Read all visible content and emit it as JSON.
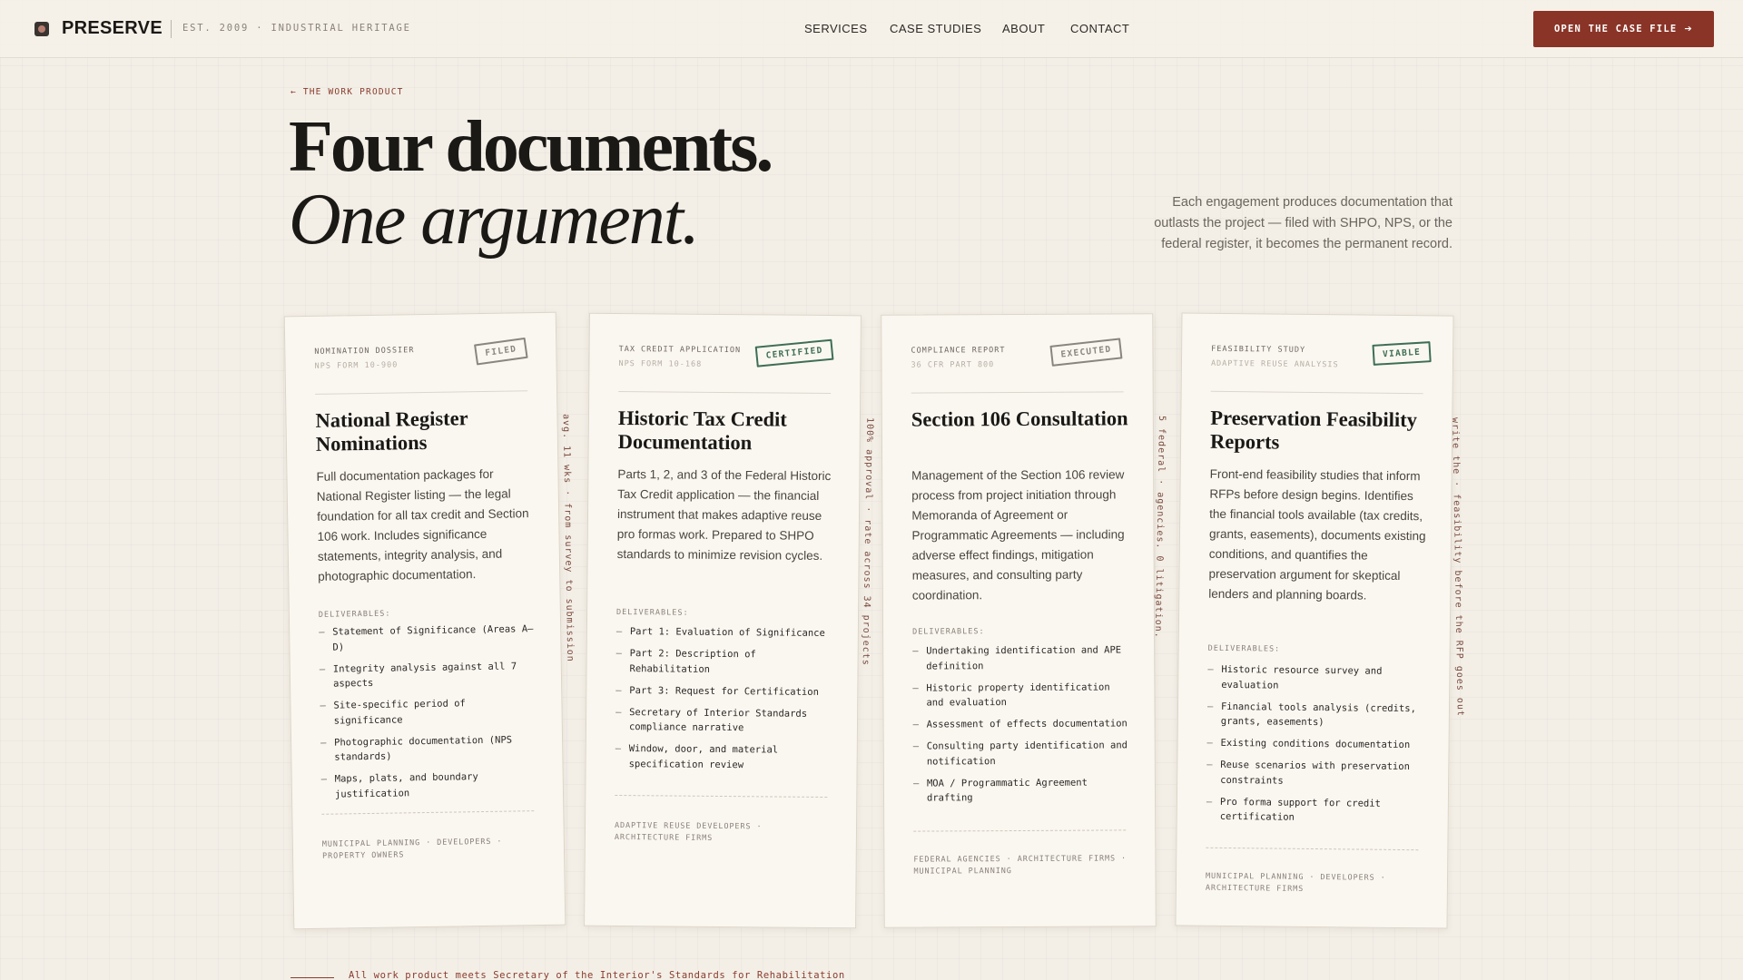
{
  "header": {
    "brand": "PRESERVE",
    "tagline": "EST. 2009 · INDUSTRIAL HERITAGE",
    "nav": [
      "SERVICES",
      "CASE STUDIES",
      "ABOUT",
      "CONTACT"
    ],
    "cta": "OPEN THE CASE FILE",
    "cta_icon": "arrow-right-icon"
  },
  "hero": {
    "back_link": "← THE WORK PRODUCT",
    "title_line1": "Four documents.",
    "title_line2": "One argument.",
    "intro": "Each engagement produces documentation that outlasts the project — filed with SHPO, NPS, or the federal register, it becomes the permanent record."
  },
  "cards": [
    {
      "kicker": "NOMINATION DOSSIER",
      "form": "NPS FORM 10-900",
      "stamp": "FILED",
      "stamp_color": "#8a857f",
      "title": "National Register Nominations",
      "description": "Full documentation packages for National Register listing — the legal foundation for all tax credit and Section 106 work. Includes significance statements, integrity analysis, and photographic documentation.",
      "deliverables_label": "DELIVERABLES:",
      "deliverables": [
        "Statement of Significance (Areas A–D)",
        "Integrity analysis against all 7 aspects",
        "Site-specific period of significance",
        "Photographic documentation (NPS standards)",
        "Maps, plats, and boundary justification"
      ],
      "audience": "MUNICIPAL PLANNING · DEVELOPERS · PROPERTY OWNERS",
      "side_note": "avg. 11 wks · from survey to submission"
    },
    {
      "kicker": "TAX CREDIT APPLICATION",
      "form": "NPS FORM 10-168",
      "stamp": "CERTIFIED",
      "stamp_color": "#3e6e54",
      "title": "Historic Tax Credit Documentation",
      "description": "Parts 1, 2, and 3 of the Federal Historic Tax Credit application — the financial instrument that makes adaptive reuse pro formas work. Prepared to SHPO standards to minimize revision cycles.",
      "deliverables_label": "DELIVERABLES:",
      "deliverables": [
        "Part 1: Evaluation of Significance",
        "Part 2: Description of Rehabilitation",
        "Part 3: Request for Certification",
        "Secretary of Interior Standards compliance narrative",
        "Window, door, and material specification review"
      ],
      "audience": "ADAPTIVE REUSE DEVELOPERS · ARCHITECTURE FIRMS",
      "side_note": "100% approval · rate across 34 projects"
    },
    {
      "kicker": "COMPLIANCE REPORT",
      "form": "36 CFR PART 800",
      "stamp": "EXECUTED",
      "stamp_color": "#8a857f",
      "title": "Section 106 Consultation",
      "description": "Management of the Section 106 review process from project initiation through Memoranda of Agreement or Programmatic Agreements — including adverse effect findings, mitigation measures, and consulting party coordination.",
      "deliverables_label": "DELIVERABLES:",
      "deliverables": [
        "Undertaking identification and APE definition",
        "Historic property identification and evaluation",
        "Assessment of effects documentation",
        "Consulting party identification and notification",
        "MOA / Programmatic Agreement drafting"
      ],
      "audience": "FEDERAL AGENCIES · ARCHITECTURE FIRMS · MUNICIPAL PLANNING",
      "side_note": "5 federal · agencies. 0 litigation."
    },
    {
      "kicker": "FEASIBILITY STUDY",
      "form": "ADAPTIVE REUSE ANALYSIS",
      "stamp": "VIABLE",
      "stamp_color": "#3e6e54",
      "title": "Preservation Feasibility Reports",
      "description": "Front-end feasibility studies that inform RFPs before design begins. Identifies the financial tools available (tax credits, grants, easements), documents existing conditions, and quantifies the preservation argument for skeptical lenders and planning boards.",
      "deliverables_label": "DELIVERABLES:",
      "deliverables": [
        "Historic resource survey and evaluation",
        "Financial tools analysis (credits, grants, easements)",
        "Existing conditions documentation",
        "Reuse scenarios with preservation constraints",
        "Pro forma support for credit certification"
      ],
      "audience": "MUNICIPAL PLANNING · DEVELOPERS · ARCHITECTURE FIRMS",
      "side_note": "write the · feasibility before the RFP goes out"
    }
  ],
  "footer_note": "All work product meets Secretary of the Interior's Standards for Rehabilitation"
}
